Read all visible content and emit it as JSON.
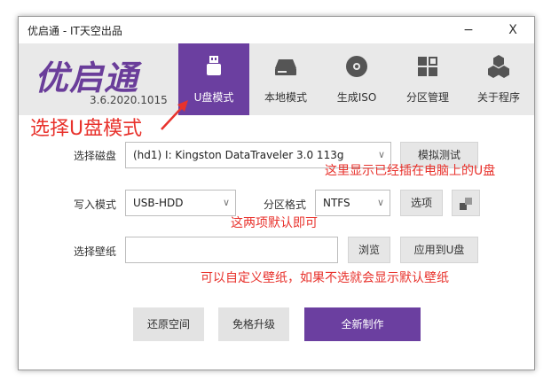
{
  "window": {
    "title": "优启通 - IT天空出品",
    "minimize": "−",
    "close": "X"
  },
  "header": {
    "logo": "优启通",
    "version": "3.6.2020.1015"
  },
  "tabs": [
    {
      "label": "U盘模式",
      "icon": "usb-drive-icon",
      "active": true
    },
    {
      "label": "本地模式",
      "icon": "hard-disk-icon",
      "active": false
    },
    {
      "label": "生成ISO",
      "icon": "disc-icon",
      "active": false
    },
    {
      "label": "分区管理",
      "icon": "partition-grid-icon",
      "active": false
    },
    {
      "label": "关于程序",
      "icon": "hexagon-cluster-icon",
      "active": false
    }
  ],
  "form": {
    "disk_label": "选择磁盘",
    "disk_value": "(hd1) I: Kingston DataTraveler 3.0 113g",
    "simulate_button": "模拟测试",
    "write_mode_label": "写入模式",
    "write_mode_value": "USB-HDD",
    "partition_format_label": "分区格式",
    "partition_format_value": "NTFS",
    "options_button": "选项",
    "wallpaper_label": "选择壁纸",
    "wallpaper_value": "",
    "browse_button": "浏览",
    "apply_button": "应用到U盘"
  },
  "actions": {
    "restore": "还原空间",
    "upgrade": "免格升级",
    "create": "全新制作"
  },
  "annotations": {
    "select_mode": "选择U盘模式",
    "disk_note": "这里显示已经插在电脑上的U盘",
    "defaults_note": "这两项默认即可",
    "wallpaper_note": "可以自定义壁纸，如果不选就会显示默认壁纸"
  },
  "colors": {
    "accent": "#6b3fa0",
    "annotation": "#e8322c",
    "header_bg": "#e9e9e9"
  }
}
